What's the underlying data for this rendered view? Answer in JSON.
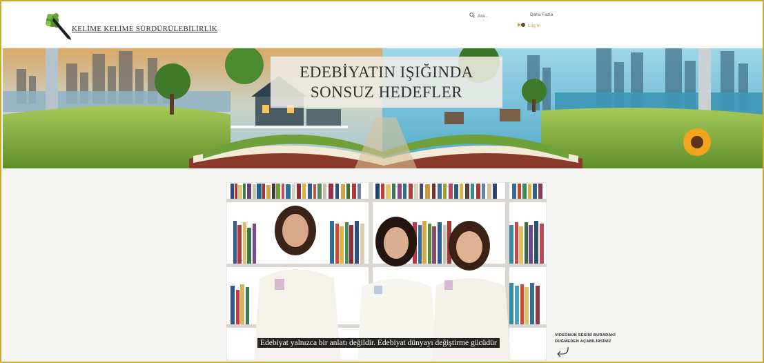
{
  "header": {
    "logo_text": "KELİME KELİME SÜRDÜRÜLEBİLİRLİK",
    "search_label": "Ara...",
    "more_label": "Daha Fazla",
    "login_label": "Log In"
  },
  "banner": {
    "title_line1": "EDEBİYATIN IŞIĞINDA",
    "title_line2": "SONSUZ HEDEFLER"
  },
  "video": {
    "subtitle": "Edebiyat yalnızca bir anlatı değildir. Edebiyat dünyayı değiştirme gücüdür"
  },
  "hint": {
    "line1": "VİDEONUN  SESİNİ  BURADAKİ",
    "line2": "DÜĞMEDEN AÇABİLİRSİNİZ"
  },
  "colors": {
    "accent_gold": "#c9a23b",
    "frame": "#c9ad3a",
    "page_bg": "#f4f4f2"
  },
  "icons": [
    "logo-leaf-pen-icon",
    "search-icon",
    "user-avatar-icon",
    "return-arrow-icon"
  ]
}
